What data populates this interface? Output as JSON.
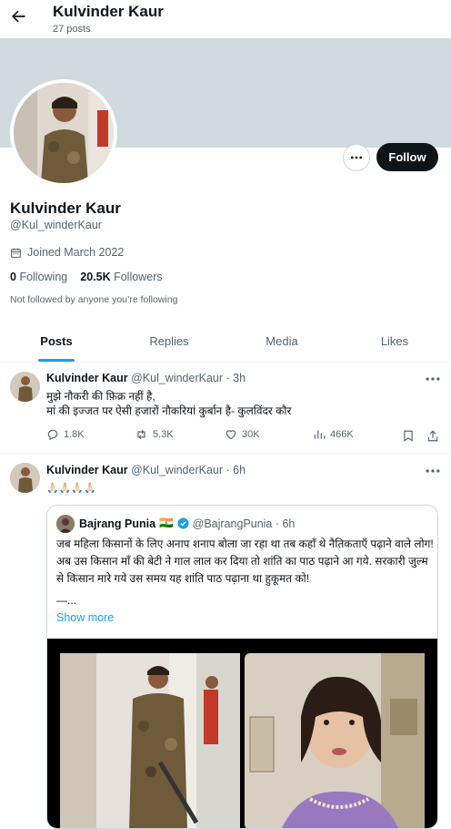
{
  "header": {
    "name": "Kulvinder Kaur",
    "post_count": "27 posts"
  },
  "profile": {
    "name": "Kulvinder Kaur",
    "handle": "@Kul_winderKaur",
    "joined": "Joined March 2022",
    "following_count": "0",
    "following_label": "Following",
    "followers_count": "20.5K",
    "followers_label": "Followers",
    "not_followed": "Not followed by anyone you’re following",
    "follow_button": "Follow"
  },
  "tabs": [
    {
      "label": "Posts",
      "active": true
    },
    {
      "label": "Replies",
      "active": false
    },
    {
      "label": "Media",
      "active": false
    },
    {
      "label": "Likes",
      "active": false
    }
  ],
  "posts": [
    {
      "author": "Kulvinder Kaur",
      "handle_time": "@Kul_winderKaur · 3h",
      "lines": [
        "मुझे नौकरी की फ़िक्र नहीं है,",
        "मां की इज्जत पर ऐसी हजारों नौकरियां कुर्बान है- कुलविंदर कौर"
      ],
      "replies": "1.8K",
      "reposts": "5.3K",
      "likes": "30K",
      "views": "466K"
    },
    {
      "author": "Kulvinder Kaur",
      "handle_time": "@Kul_winderKaur · 6h",
      "emoji": "🙏🏻🙏🏻🙏🏻🙏🏻",
      "quote": {
        "author": "Bajrang Punia",
        "flag": "🇮🇳",
        "handle_time": "@BajrangPunia · 6h",
        "text": "जब महिला किसानों के लिए अनाप शनाप बोला जा रहा था तब कहाँ थे नैतिकताएँ पढ़ाने वाले लोग! अब उस किसान माँ की बेटी ने गाल लाल कर दिया तो शांति का पाठ पढ़ाने आ गये. सरकारी जुल्म से किसान मारे गये उस समय यह शांति पाठ पढ़ाना था हुकूमत को!",
        "dash": "—...",
        "show_more": "Show more"
      }
    }
  ],
  "colors": {
    "accent": "#1d9bf0",
    "text": "#0f1419",
    "muted": "#536471",
    "banner": "#cfd9de"
  }
}
